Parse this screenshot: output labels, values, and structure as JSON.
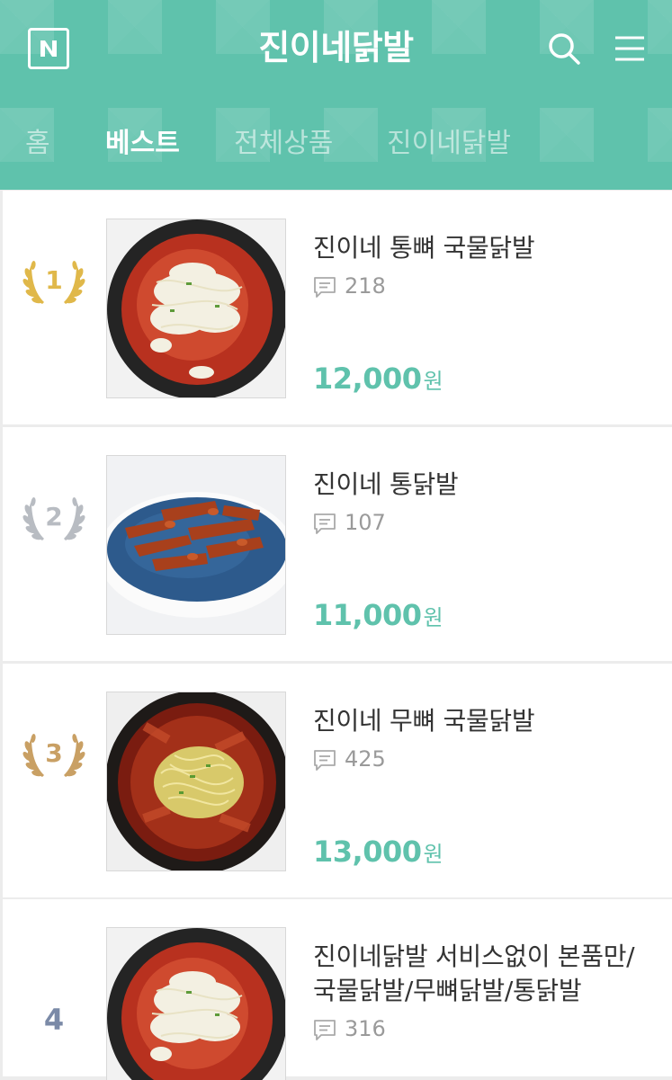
{
  "header": {
    "title": "진이네닭발",
    "logo_icon": "naver-n-logo-icon",
    "search_icon": "search-icon",
    "menu_icon": "hamburger-menu-icon"
  },
  "tabs": [
    {
      "label": "홈",
      "active": false
    },
    {
      "label": "베스트",
      "active": true
    },
    {
      "label": "전체상품",
      "active": false
    },
    {
      "label": "진이네닭발",
      "active": false
    }
  ],
  "colors": {
    "brand": "#5fc2ac",
    "gold": "#e0b84a",
    "silver": "#b8bcc2",
    "bronze": "#c9a064",
    "rank_plain": "#7b8aa7"
  },
  "products": [
    {
      "rank": "1",
      "rank_style": "gold-laurel",
      "name": "진이네 통뼈 국물닭발",
      "reviews": "218",
      "price": "12,000",
      "currency": "원",
      "thumb": "spicy chicken feet soup with bean sprouts and cabbage in black pan"
    },
    {
      "rank": "2",
      "rank_style": "silver-laurel",
      "name": "진이네 통닭발",
      "reviews": "107",
      "price": "11,000",
      "currency": "원",
      "thumb": "spicy chicken feet on blue plate"
    },
    {
      "rank": "3",
      "rank_style": "bronze-laurel",
      "name": "진이네 무뼈 국물닭발",
      "reviews": "425",
      "price": "13,000",
      "currency": "원",
      "thumb": "boneless spicy chicken feet with bean sprouts in black pan"
    },
    {
      "rank": "4",
      "rank_style": "plain",
      "name": "진이네닭발 서비스없이 본품만/국물닭발/무뼈닭발/통닭발",
      "reviews": "316",
      "price": "",
      "currency": "",
      "thumb": "spicy chicken feet soup with bean sprouts and cabbage in black pan"
    }
  ]
}
